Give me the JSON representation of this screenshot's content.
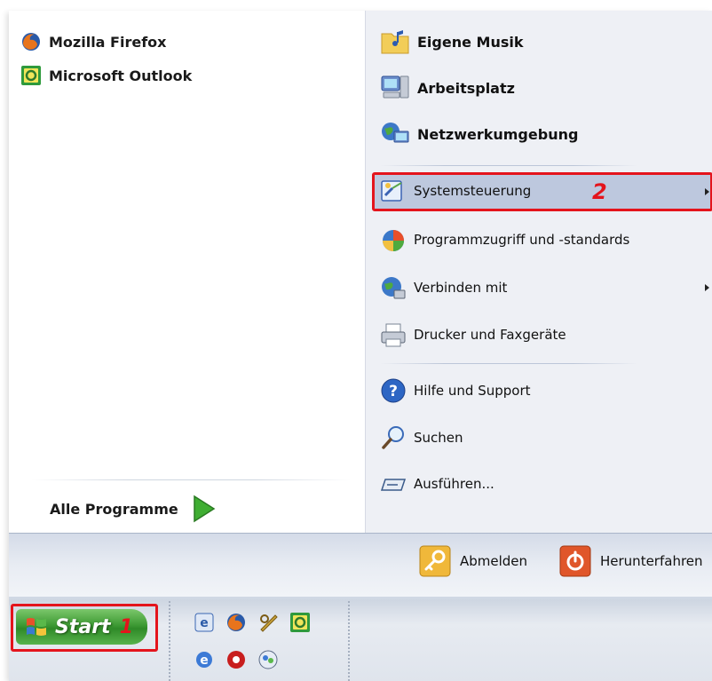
{
  "left_panel": {
    "pinned": [
      {
        "label": "Mozilla Firefox",
        "icon": "firefox-icon"
      },
      {
        "label": "Microsoft Outlook",
        "icon": "outlook-icon"
      }
    ],
    "all_programs_label": "Alle Programme"
  },
  "right_panel": {
    "places": [
      {
        "label": "Eigene Musik",
        "icon": "music-folder-icon"
      },
      {
        "label": "Arbeitsplatz",
        "icon": "computer-icon"
      },
      {
        "label": "Netzwerkumgebung",
        "icon": "network-icon"
      }
    ],
    "system": [
      {
        "label": "Systemsteuerung",
        "icon": "control-panel-icon",
        "submenu": true
      },
      {
        "label": "Programmzugriff und -standards",
        "icon": "program-defaults-icon",
        "submenu": false
      },
      {
        "label": "Verbinden mit",
        "icon": "connect-icon",
        "submenu": true
      },
      {
        "label": "Drucker und Faxgeräte",
        "icon": "printer-icon",
        "submenu": false
      }
    ],
    "help": [
      {
        "label": "Hilfe und Support",
        "icon": "help-icon"
      },
      {
        "label": "Suchen",
        "icon": "search-icon"
      },
      {
        "label": "Ausführen...",
        "icon": "run-icon"
      }
    ]
  },
  "annotations": {
    "marker_1": "1",
    "marker_2": "2",
    "highlight_color": "#e4141c"
  },
  "bottom_bar": {
    "logoff_label": "Abmelden",
    "shutdown_label": "Herunterfahren"
  },
  "taskbar": {
    "start_label": "Start",
    "quick_launch": [
      "ie-quick-icon",
      "firefox-quick-icon",
      "tool-quick-icon",
      "outlook-quick-icon",
      "ie-blue-quick-icon",
      "media-quick-icon",
      "messenger-quick-icon"
    ]
  },
  "colors": {
    "start_green": "#3e9a34",
    "highlight_bg": "#bdc8de",
    "right_panel_bg": "#eef0f5"
  }
}
